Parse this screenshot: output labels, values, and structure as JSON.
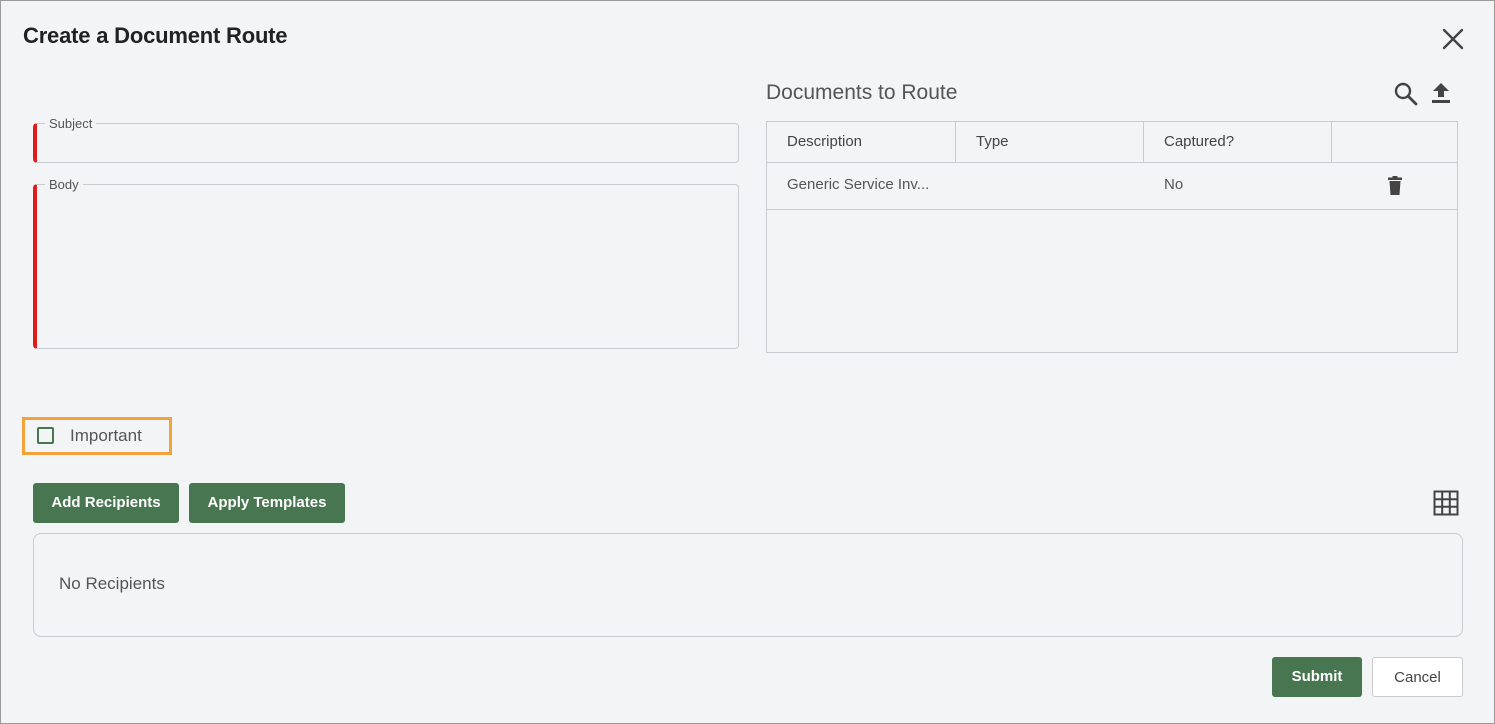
{
  "dialog": {
    "title": "Create a Document Route"
  },
  "form": {
    "subject_label": "Subject",
    "subject_value": "",
    "body_label": "Body",
    "body_value": ""
  },
  "documents": {
    "title": "Documents to Route",
    "columns": [
      "Description",
      "Type",
      "Captured?",
      ""
    ],
    "rows": [
      {
        "description": "Generic Service Inv...",
        "type": "",
        "captured": "No"
      }
    ]
  },
  "important": {
    "label": "Important",
    "checked": false
  },
  "recipients": {
    "add_label": "Add Recipients",
    "apply_templates_label": "Apply Templates",
    "empty_text": "No Recipients"
  },
  "footer": {
    "submit_label": "Submit",
    "cancel_label": "Cancel"
  },
  "colors": {
    "primary_green": "#487650",
    "required_red": "#e11b1b",
    "highlight_orange": "#f4a33a"
  },
  "icons": [
    "close-icon",
    "search-icon",
    "upload-icon",
    "trash-icon",
    "grid-icon"
  ]
}
